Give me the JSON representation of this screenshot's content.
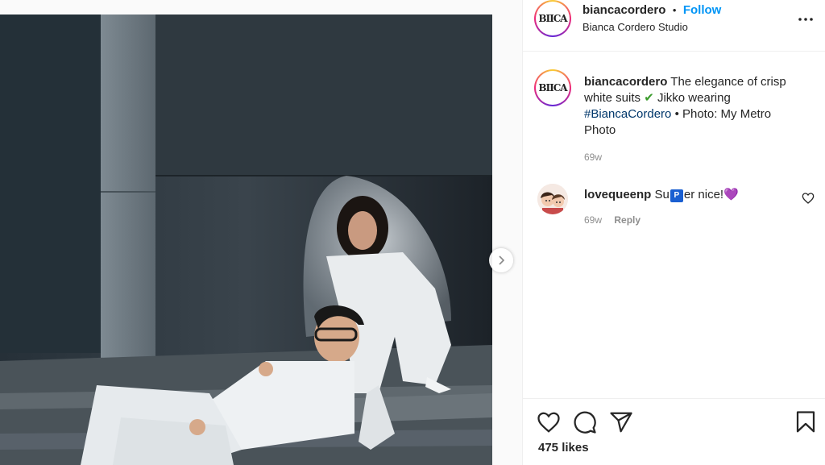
{
  "post": {
    "image_alt": "Couple in white suits posing on concrete steps"
  },
  "header": {
    "avatar_text": "BIICA",
    "username": "biancacordero",
    "separator": "•",
    "follow_label": "Follow",
    "subtitle": "Bianca Cordero Studio"
  },
  "caption": {
    "avatar_text": "BIICA",
    "username": "biancacordero",
    "text_part1": "The elegance of crisp white suits",
    "check_emoji": "✔",
    "text_part2": "Jikko wearing",
    "hashtag": "#BiancaCordero",
    "text_part3": "• Photo: My Metro Photo",
    "time": "69w"
  },
  "comment": {
    "username": "lovequeenp",
    "text_before": "Su",
    "badge": "P",
    "text_after": "er nice!",
    "heart_emoji": "💜",
    "time": "69w",
    "reply_label": "Reply"
  },
  "footer": {
    "likes": "475 likes"
  },
  "icons": {
    "heart": "heart-icon",
    "comment": "comment-icon",
    "share": "share-icon",
    "save": "bookmark-icon",
    "more": "more-icon",
    "next": "chevron-right-icon"
  },
  "colors": {
    "follow": "#0095f6",
    "hashtag": "#00376b",
    "muted": "#8e8e8e",
    "check": "#3a9b2b"
  }
}
